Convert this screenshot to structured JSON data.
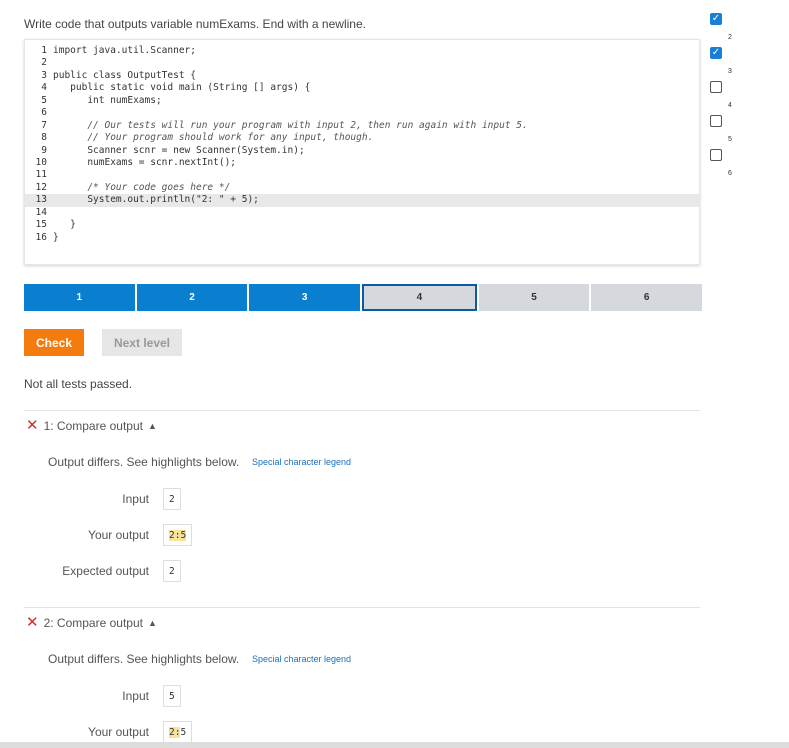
{
  "instructions": "Write code that outputs variable numExams. End with a newline.",
  "code": {
    "lines": [
      {
        "n": "1",
        "text": "import java.util.Scanner;"
      },
      {
        "n": "2",
        "text": ""
      },
      {
        "n": "3",
        "text": "public class OutputTest {"
      },
      {
        "n": "4",
        "text": "   public static void main (String [] args) {"
      },
      {
        "n": "5",
        "text": "      int numExams;"
      },
      {
        "n": "6",
        "text": ""
      },
      {
        "n": "7",
        "text": "      // Our tests will run your program with input 2, then run again with input 5."
      },
      {
        "n": "8",
        "text": "      // Your program should work for any input, though."
      },
      {
        "n": "9",
        "text": "      Scanner scnr = new Scanner(System.in);"
      },
      {
        "n": "10",
        "text": "      numExams = scnr.nextInt();"
      },
      {
        "n": "11",
        "text": ""
      },
      {
        "n": "12",
        "text": "      /* Your code goes here */"
      },
      {
        "n": "13",
        "text": "      System.out.println(\"2: \" + 5);"
      },
      {
        "n": "14",
        "text": ""
      },
      {
        "n": "15",
        "text": "   }"
      },
      {
        "n": "16",
        "text": "}"
      }
    ],
    "active_line": "13"
  },
  "progress": {
    "levels": [
      "1",
      "2",
      "3",
      "4",
      "5",
      "6"
    ],
    "completed": 3,
    "current": "4"
  },
  "buttons": {
    "check": "Check",
    "next_level": "Next level"
  },
  "status": "Not all tests passed.",
  "tests": [
    {
      "header": "1: Compare output",
      "differs": "Output differs. See highlights below.",
      "legend": "Special character legend",
      "input_label": "Input",
      "input_value": "2",
      "your_output_label": "Your output",
      "your_output_hl": "2:",
      "your_output_rest": " 5",
      "expected_label": "Expected output",
      "expected_value": "2"
    },
    {
      "header": "2: Compare output",
      "differs": "Output differs. See highlights below.",
      "legend": "Special character legend",
      "input_label": "Input",
      "input_value": "5",
      "your_output_label": "Your output",
      "your_output_hl": "2:",
      "your_output_rest": " 5"
    }
  ],
  "sidebar": {
    "items": [
      {
        "num": "2",
        "checked": true
      },
      {
        "num": "3",
        "checked": true
      },
      {
        "num": "4",
        "checked": false
      },
      {
        "num": "5",
        "checked": false
      },
      {
        "num": "6",
        "checked": false
      }
    ]
  },
  "colors": {
    "accent_blue": "#0a7fd0",
    "check_orange": "#f47c0e",
    "error_red": "#d0302a",
    "highlight_yellow": "#f9e39a"
  }
}
